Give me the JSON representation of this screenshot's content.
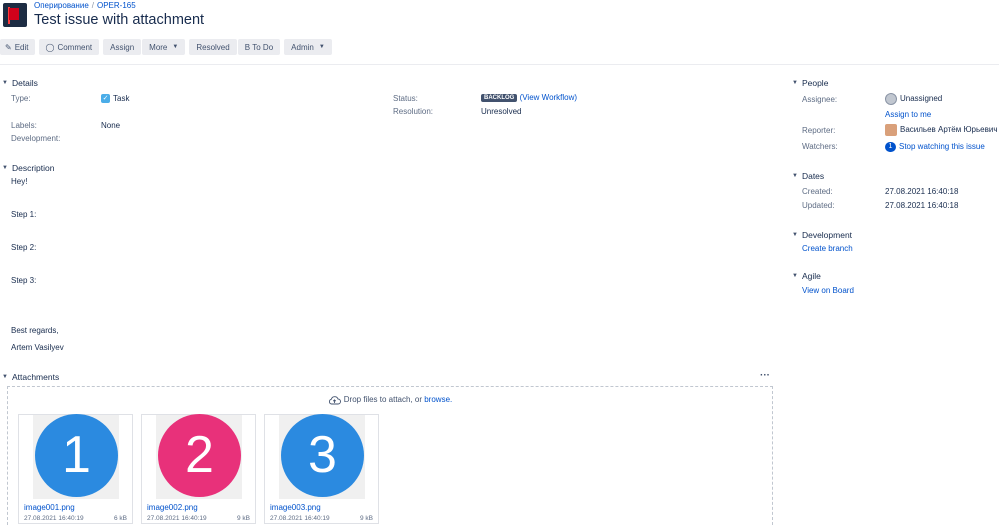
{
  "breadcrumbs": {
    "project": "Оперирование",
    "issue_key": "OPER-165"
  },
  "title": "Test issue with attachment",
  "toolbar": {
    "edit": "Edit",
    "comment": "Comment",
    "assign": "Assign",
    "more": "More",
    "resolved": "Resolved",
    "to_do": "В To Do",
    "admin": "Admin"
  },
  "details": {
    "heading": "Details",
    "type_label": "Type:",
    "type_value": "Task",
    "labels_label": "Labels:",
    "labels_value": "None",
    "development_label": "Development:",
    "status_label": "Status:",
    "status_value": "BACKLOG",
    "view_workflow": "(View Workflow)",
    "resolution_label": "Resolution:",
    "resolution_value": "Unresolved"
  },
  "description": {
    "heading": "Description",
    "lines": [
      "Hey!",
      "Step 1:",
      "Step 2:",
      "Step 3:",
      "Best regards,",
      "Artem Vasilyev"
    ]
  },
  "attachments": {
    "heading": "Attachments",
    "menu": "···",
    "drop_text": "Drop files to attach, or ",
    "browse": "browse.",
    "files": [
      {
        "number": "1",
        "name": "image001.png",
        "date": "27.08.2021 16:40:19",
        "size": "6 kB",
        "color": "#2b8ae0"
      },
      {
        "number": "2",
        "name": "image002.png",
        "date": "27.08.2021 16:40:19",
        "size": "9 kB",
        "color": "#e8317a"
      },
      {
        "number": "3",
        "name": "image003.png",
        "date": "27.08.2021 16:40:19",
        "size": "9 kB",
        "color": "#2b8ae0"
      }
    ]
  },
  "people": {
    "heading": "People",
    "assignee_label": "Assignee:",
    "assignee_value": "Unassigned",
    "assign_to_me": "Assign to me",
    "reporter_label": "Reporter:",
    "reporter_value": "Васильев Артём Юрьевич",
    "watchers_label": "Watchers:",
    "watchers_count": "1",
    "watchers_action": "Stop watching this issue"
  },
  "dates": {
    "heading": "Dates",
    "created_label": "Created:",
    "created_value": "27.08.2021 16:40:18",
    "updated_label": "Updated:",
    "updated_value": "27.08.2021 16:40:18"
  },
  "development": {
    "heading": "Development",
    "create_branch": "Create branch"
  },
  "agile": {
    "heading": "Agile",
    "view_on_board": "View on Board"
  },
  "colors": {
    "link": "#0052cc",
    "button_bg": "#ebecf0",
    "project_avatar": "#1d2c43"
  }
}
